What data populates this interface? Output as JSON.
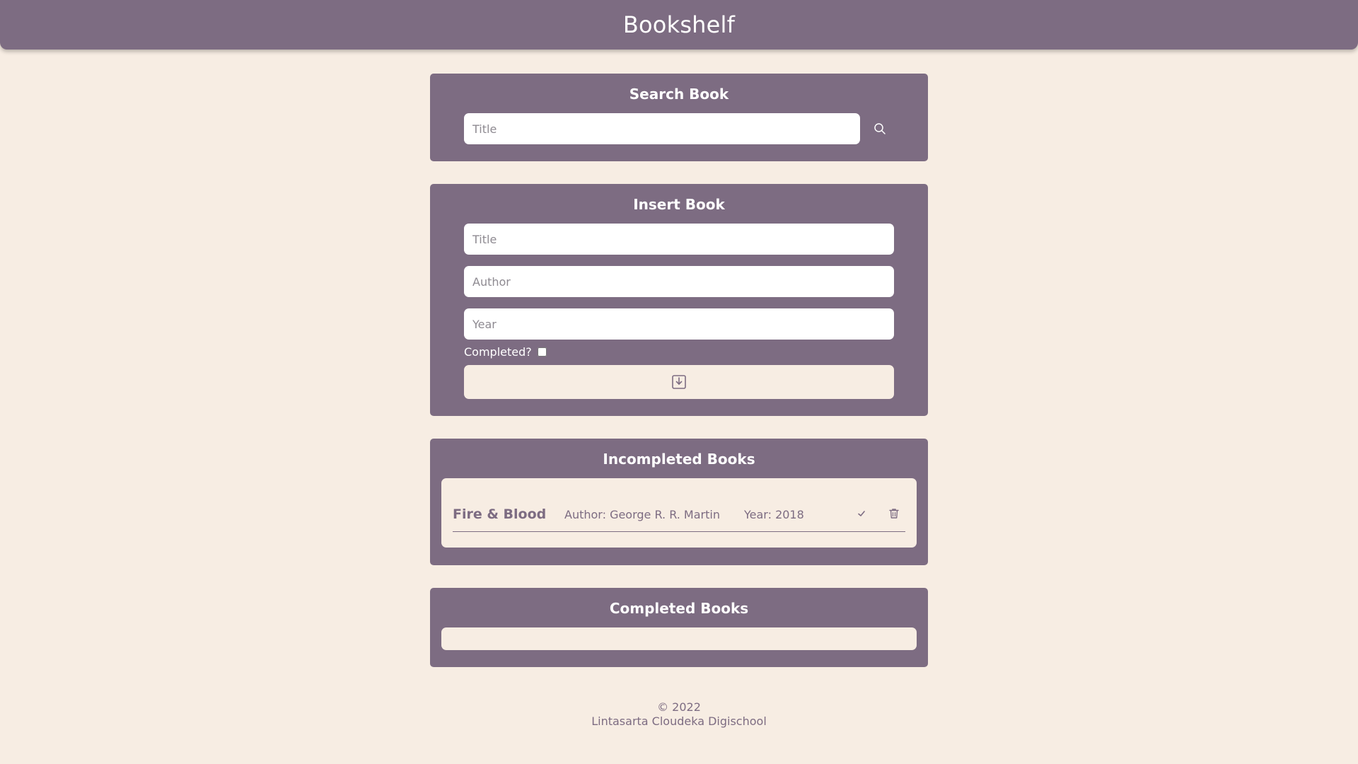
{
  "header": {
    "title": "Bookshelf"
  },
  "search": {
    "heading": "Search Book",
    "title_placeholder": "Title",
    "title_value": "",
    "button_icon": "search-icon"
  },
  "insert": {
    "heading": "Insert Book",
    "title_placeholder": "Title",
    "author_placeholder": "Author",
    "year_placeholder": "Year",
    "completed_label": "Completed?",
    "completed_checked": false,
    "submit_icon": "save-download-icon"
  },
  "incomplete": {
    "heading": "Incompleted Books",
    "books": [
      {
        "title": "Fire & Blood",
        "author": "Author: George R. R. Martin",
        "year": "Year: 2018",
        "actions": [
          "check-icon",
          "trash-icon"
        ]
      }
    ]
  },
  "complete": {
    "heading": "Completed Books",
    "books": []
  },
  "footer": {
    "copyright": "© 2022",
    "owner": "Lintasarta Cloudeka Digischool"
  },
  "colors": {
    "primary": "#7d6c82",
    "background": "#f7ede3",
    "white": "#ffffff"
  }
}
